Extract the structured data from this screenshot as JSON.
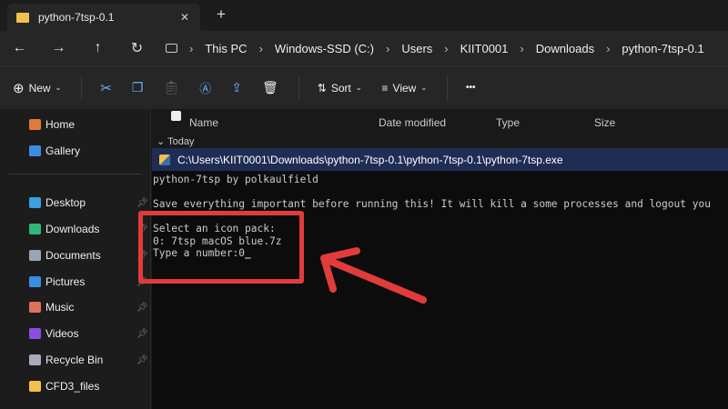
{
  "tab": {
    "title": "python-7tsp-0.1",
    "close": "✕",
    "new": "+"
  },
  "nav": {
    "back": "←",
    "forward": "→",
    "up": "↑",
    "refresh": "↻",
    "breadcrumb": [
      "This PC",
      "Windows-SSD (C:)",
      "Users",
      "KIIT0001",
      "Downloads",
      "python-7tsp-0.1"
    ]
  },
  "toolbar": {
    "new": "New",
    "sort": "Sort",
    "view": "View",
    "more": "•••"
  },
  "columns": {
    "name": "Name",
    "date": "Date modified",
    "type": "Type",
    "size": "Size"
  },
  "group": "Today",
  "sidebar": [
    {
      "label": "Home",
      "color": "#e07a3a"
    },
    {
      "label": "Gallery",
      "color": "#3a8ee0"
    },
    {
      "label": "Desktop",
      "color": "#3aa0e0",
      "pinned": true
    },
    {
      "label": "Downloads",
      "color": "#2eb87a",
      "pinned": true
    },
    {
      "label": "Documents",
      "color": "#9aa6b8",
      "pinned": true
    },
    {
      "label": "Pictures",
      "color": "#3a8ee0",
      "pinned": true
    },
    {
      "label": "Music",
      "color": "#e0705a",
      "pinned": true
    },
    {
      "label": "Videos",
      "color": "#8a4ee0",
      "pinned": true
    },
    {
      "label": "Recycle Bin",
      "color": "#aab",
      "pinned": true
    },
    {
      "label": "CFD3_files",
      "color": "#f2c14e"
    }
  ],
  "console": {
    "title": "C:\\Users\\KIIT0001\\Downloads\\python-7tsp-0.1\\python-7tsp-0.1\\python-7tsp.exe",
    "lines": [
      "python-7tsp by polkaulfield",
      "",
      "Save everything important before running this! It will kill a some processes and logout you",
      "",
      "Select an icon pack:",
      "0: 7tsp macOS blue.7z",
      "Type a number:0"
    ]
  },
  "annotation_color": "#e23b3b"
}
